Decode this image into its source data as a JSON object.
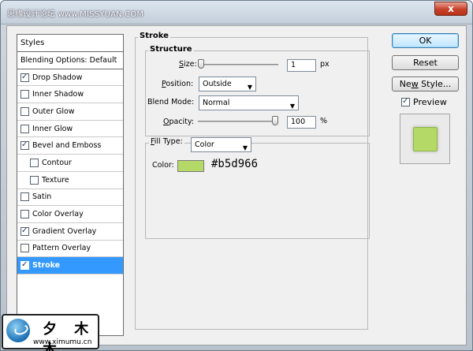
{
  "window": {
    "watermark": "思缘设计论坛  www.MISSYUAN.COM",
    "close_label": "x"
  },
  "styles": {
    "header": "Styles",
    "blending_options": "Blending Options: Default",
    "items": [
      {
        "label": "Drop Shadow",
        "checked": true,
        "indent": false
      },
      {
        "label": "Inner Shadow",
        "checked": false,
        "indent": false
      },
      {
        "label": "Outer Glow",
        "checked": false,
        "indent": false
      },
      {
        "label": "Inner Glow",
        "checked": false,
        "indent": false
      },
      {
        "label": "Bevel and Emboss",
        "checked": true,
        "indent": false
      },
      {
        "label": "Contour",
        "checked": false,
        "indent": true
      },
      {
        "label": "Texture",
        "checked": false,
        "indent": true
      },
      {
        "label": "Satin",
        "checked": false,
        "indent": false
      },
      {
        "label": "Color Overlay",
        "checked": false,
        "indent": false
      },
      {
        "label": "Gradient Overlay",
        "checked": true,
        "indent": false
      },
      {
        "label": "Pattern Overlay",
        "checked": false,
        "indent": false
      },
      {
        "label": "Stroke",
        "checked": true,
        "indent": false,
        "selected": true
      }
    ]
  },
  "stroke": {
    "title": "Stroke",
    "structure_title": "Structure",
    "size_label_u": "S",
    "size_label_rest": "ize:",
    "size_value": "1",
    "size_unit": "px",
    "size_level": 0.0,
    "position_label_u": "P",
    "position_label_rest": "osition:",
    "position_value": "Outside",
    "blend_mode_label": "Blend Mode:",
    "blend_mode_value": "Normal",
    "opacity_label_u": "O",
    "opacity_label_rest": "pacity:",
    "opacity_value": "100",
    "opacity_unit": "%",
    "opacity_level": 1.0,
    "fill_type_label_u": "F",
    "fill_type_label_rest": "ill Type:",
    "fill_type_value": "Color",
    "color_label": "Color:",
    "color_hex": "#b5d966"
  },
  "buttons": {
    "ok": "OK",
    "reset": "Reset",
    "new_style_u": "w",
    "new_style_pre": "Ne",
    "new_style_post": " Style...",
    "preview_label": "Preview",
    "preview_checked": true
  },
  "logo": {
    "name": "夕 木 木",
    "url": "www.ximumu.cn"
  },
  "colors": {
    "stroke_color": "#b5d966",
    "selection": "#3399ff"
  }
}
